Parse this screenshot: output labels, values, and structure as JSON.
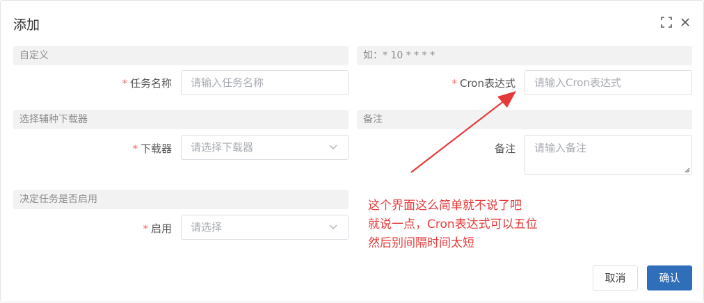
{
  "dialog": {
    "title": "添加",
    "maximize_icon": "maximize-icon",
    "close_icon": "close-icon"
  },
  "left": {
    "section_custom": "自定义",
    "task_name": {
      "label": "任务名称",
      "placeholder": "请输入任务名称",
      "required": true
    },
    "section_downloader": "选择辅种下载器",
    "downloader": {
      "label": "下载器",
      "placeholder": "请选择下载器",
      "required": true
    },
    "section_enable": "决定任务是否启用",
    "enable": {
      "label": "启用",
      "placeholder": "请选择",
      "required": true
    }
  },
  "right": {
    "section_cron_hint": "如：* 10 * * * *",
    "cron": {
      "label": "Cron表达式",
      "placeholder": "请输入Cron表达式",
      "required": true
    },
    "section_remark": "备注",
    "remark": {
      "label": "备注",
      "placeholder": "请输入备注",
      "required": false
    }
  },
  "annotation": {
    "lines": [
      "这个界面这么简单就不说了吧",
      "就说一点，Cron表达式可以五位",
      "然后别间隔时间太短"
    ],
    "color": "#e53a3a"
  },
  "footer": {
    "cancel_label": "取消",
    "ok_label": "确认"
  },
  "colors": {
    "primary": "#2f6eb8",
    "required": "#f56c6c",
    "section_bg": "#f2f2f2"
  }
}
